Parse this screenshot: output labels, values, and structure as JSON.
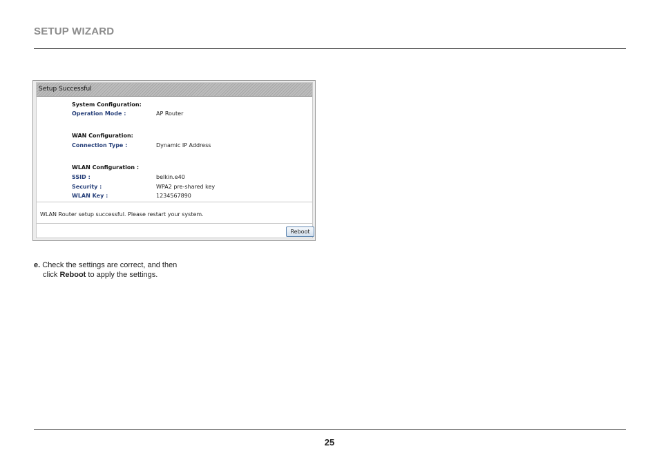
{
  "header": {
    "title": "SETUP WIZARD"
  },
  "panel": {
    "title": "Setup Successful",
    "system": {
      "heading": "System Configuration:",
      "rows": [
        {
          "label": "Operation Mode :",
          "value": "AP Router"
        }
      ]
    },
    "wan": {
      "heading": "WAN Configuration:",
      "rows": [
        {
          "label": "Connection Type :",
          "value": "Dynamic IP Address"
        }
      ]
    },
    "wlan": {
      "heading": "WLAN Configuration :",
      "rows": [
        {
          "label": "SSID :",
          "value": "belkin.e40"
        },
        {
          "label": "Security :",
          "value": "WPA2 pre-shared key"
        },
        {
          "label": "WLAN Key :",
          "value": "1234567890"
        }
      ]
    },
    "message": "WLAN Router setup successful. Please restart your system.",
    "reboot_label": "Reboot"
  },
  "instruction": {
    "step": "e.",
    "line1": "Check the settings are correct, and then",
    "line2_prefix": "click",
    "line2_bold": "Reboot",
    "line2_suffix": "to apply the settings."
  },
  "footer": {
    "page_number": "25"
  }
}
